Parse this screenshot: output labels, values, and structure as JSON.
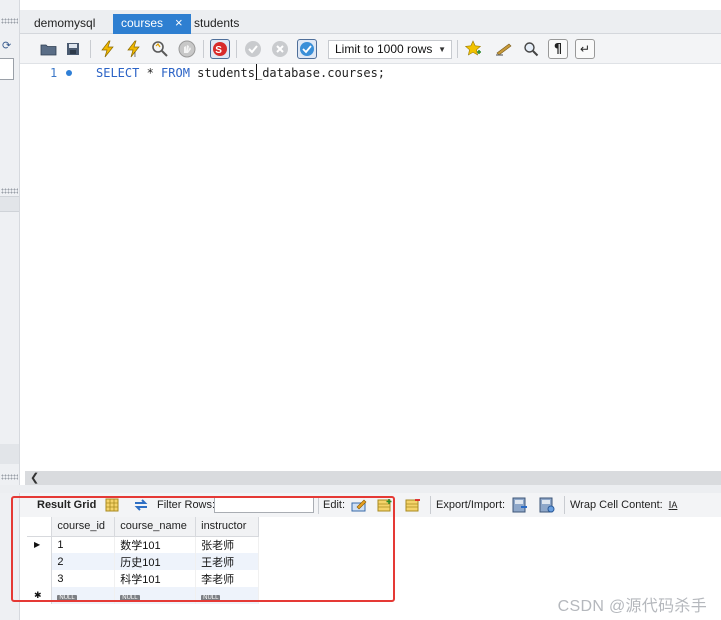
{
  "tabs": [
    {
      "label": "demomysql",
      "active": false
    },
    {
      "label": "courses",
      "active": true,
      "close": "×"
    },
    {
      "label": "students",
      "active": false
    }
  ],
  "toolbar": {
    "limit_select": "Limit to 1000 rows"
  },
  "editor": {
    "line_number": "1",
    "code": {
      "kw1": "SELECT",
      "star": " * ",
      "kw2": "FROM",
      "rest": " students_database.courses;"
    }
  },
  "result_toolbar": {
    "result_grid": "Result Grid",
    "filter_rows": "Filter Rows:",
    "filter_value": "",
    "edit": "Edit:",
    "export_import": "Export/Import:",
    "wrap_cell": "Wrap Cell Content:"
  },
  "grid": {
    "columns": [
      "course_id",
      "course_name",
      "instructor"
    ],
    "rows": [
      [
        "1",
        "数学101",
        "张老师"
      ],
      [
        "2",
        "历史101",
        "王老师"
      ],
      [
        "3",
        "科学101",
        "李老师"
      ]
    ],
    "null_label": "NULL"
  },
  "watermark": "CSDN @源代码杀手",
  "colors": {
    "accent": "#2e7fd1",
    "keyword": "#2b63c6",
    "annotation": "#e53935"
  },
  "icons": [
    "open-folder-icon",
    "save-icon",
    "execute-icon",
    "execute-current-icon",
    "explain-icon",
    "stop-icon",
    "toggle-error-icon",
    "commit-icon",
    "rollback-icon",
    "autocommit-icon",
    "bookmark-icon",
    "beautify-icon",
    "find-icon",
    "invisible-chars-icon",
    "wrap-icon"
  ]
}
